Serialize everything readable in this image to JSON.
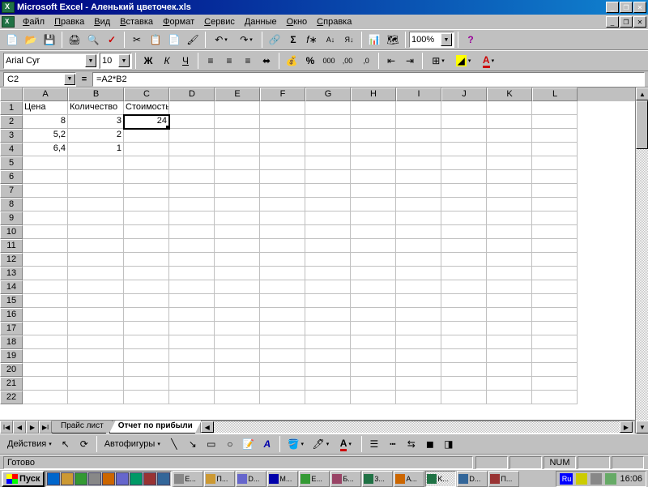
{
  "title": "Microsoft Excel - Аленький цветочек.xls",
  "menus": [
    "Файл",
    "Правка",
    "Вид",
    "Вставка",
    "Формат",
    "Сервис",
    "Данные",
    "Окно",
    "Справка"
  ],
  "format_toolbar": {
    "font": "Arial Cyr",
    "size": "10"
  },
  "zoom": "100%",
  "namebox": "C2",
  "formula": "=A2*B2",
  "columns": [
    "A",
    "B",
    "C",
    "D",
    "E",
    "F",
    "G",
    "H",
    "I",
    "J",
    "K",
    "L"
  ],
  "rows_count": 22,
  "cells": {
    "A1": "Цена",
    "B1": "Количество",
    "C1": "Стоимость",
    "A2": "8",
    "B2": "3",
    "C2": "24",
    "A3": "5,2",
    "B3": "2",
    "A4": "6,4",
    "B4": "1"
  },
  "selected_cell": "C2",
  "sheets": [
    {
      "name": "Прайс лист",
      "active": false
    },
    {
      "name": "Отчет по прибыли",
      "active": true
    }
  ],
  "draw": {
    "actions": "Действия",
    "autoshapes": "Автофигуры"
  },
  "status": {
    "ready": "Готово",
    "num": "NUM"
  },
  "taskbar": {
    "start": "Пуск",
    "tasks": [
      "E...",
      "П...",
      "D...",
      "M...",
      "E...",
      "Б...",
      "3...",
      "A...",
      "K...",
      "D...",
      "П..."
    ],
    "lang": "Ru",
    "clock": "16:06"
  }
}
